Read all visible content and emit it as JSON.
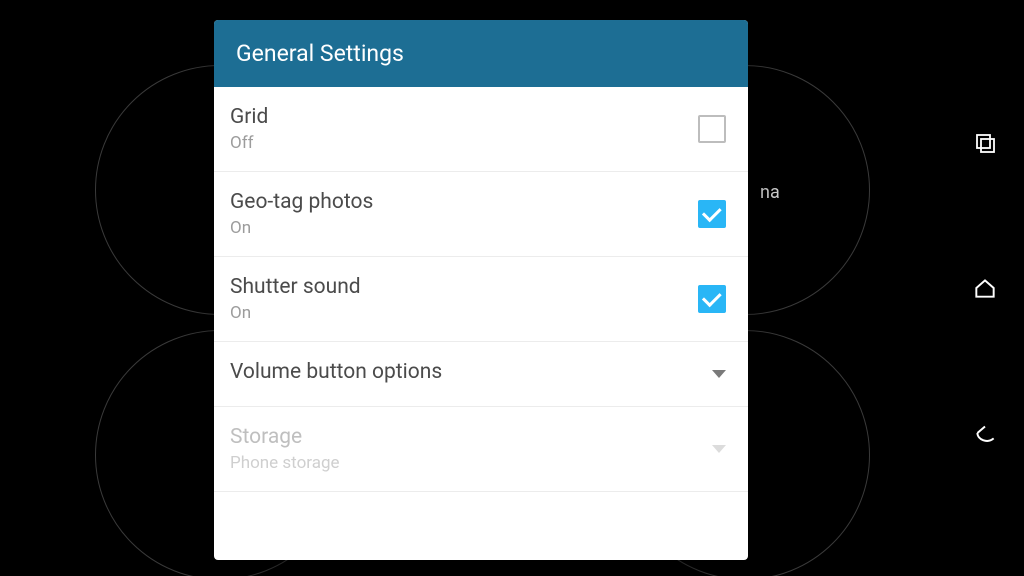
{
  "background": {
    "partial_label": "na"
  },
  "dialog": {
    "title": "General Settings",
    "items": [
      {
        "title": "Grid",
        "sub": "Off",
        "control": "checkbox",
        "checked": false
      },
      {
        "title": "Geo-tag photos",
        "sub": "On",
        "control": "checkbox",
        "checked": true
      },
      {
        "title": "Shutter sound",
        "sub": "On",
        "control": "checkbox",
        "checked": true
      },
      {
        "title": "Volume button options",
        "sub": "",
        "control": "dropdown"
      },
      {
        "title": "Storage",
        "sub": "Phone storage",
        "control": "dropdown",
        "faded": true
      }
    ]
  },
  "nav": {
    "recents": "recents",
    "home": "home",
    "back": "back"
  }
}
